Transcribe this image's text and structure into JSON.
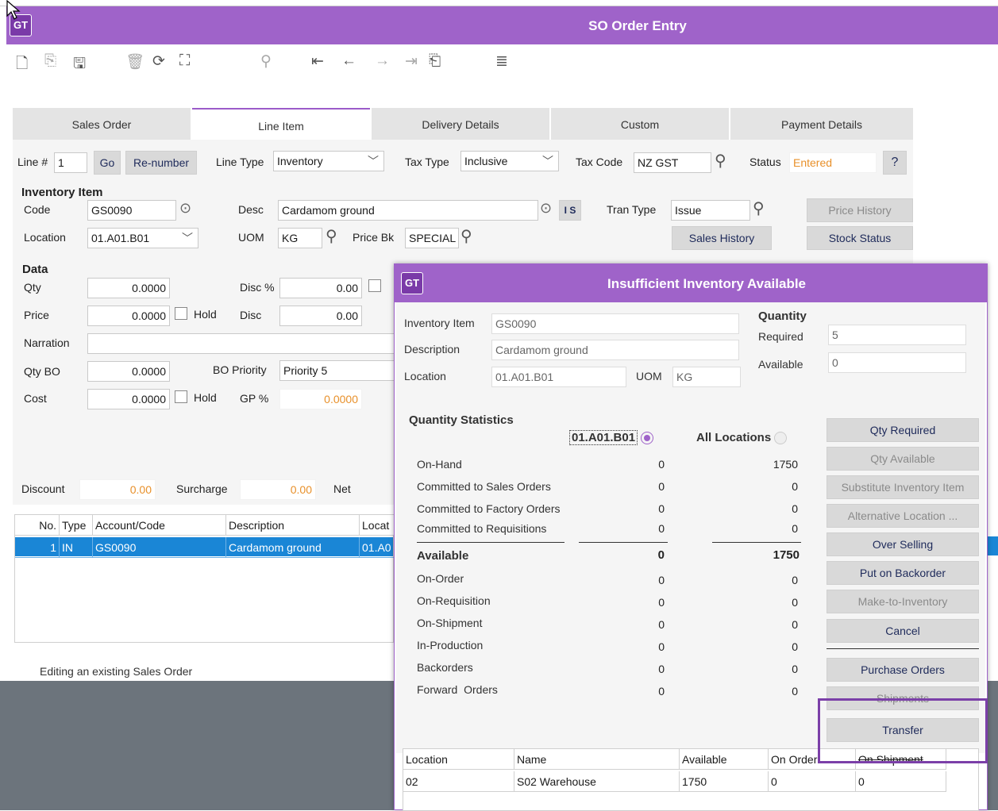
{
  "window": {
    "title": "SO Order Entry",
    "logo": "GT"
  },
  "toolbar": {
    "icons": [
      "new-icon",
      "copy-icon",
      "save-icon",
      "delete-icon",
      "refresh-icon",
      "tree-icon",
      "binoculars-icon",
      "first-icon",
      "prev-icon",
      "next-icon",
      "last-icon",
      "import-icon",
      "print-icon"
    ]
  },
  "tabs": [
    "Sales Order",
    "Line Item",
    "Delivery Details",
    "Custom",
    "Payment Details"
  ],
  "line": {
    "line_label": "Line #",
    "line_value": "1",
    "go": "Go",
    "renumber": "Re-number",
    "line_type_label": "Line Type",
    "line_type_value": "Inventory",
    "tax_type_label": "Tax Type",
    "tax_type_value": "Inclusive",
    "tax_code_label": "Tax Code",
    "tax_code_value": "NZ GST",
    "status_label": "Status",
    "status_value": "Entered"
  },
  "inventory": {
    "heading": "Inventory Item",
    "code_label": "Code",
    "code_value": "GS0090",
    "desc_label": "Desc",
    "desc_value": "Cardamom ground",
    "is_label": "I S",
    "tran_type_label": "Tran Type",
    "tran_type_value": "Issue",
    "price_history": "Price History",
    "location_label": "Location",
    "location_value": "01.A01.B01",
    "uom_label": "UOM",
    "uom_value": "KG",
    "price_bk_label": "Price Bk",
    "price_bk_value": "SPECIAL",
    "sales_history": "Sales History",
    "stock_status": "Stock Status"
  },
  "data": {
    "heading": "Data",
    "qty_label": "Qty",
    "qty_value": "0.0000",
    "disc_pct_label": "Disc %",
    "disc_pct_value": "0.00",
    "price_label": "Price",
    "price_value": "0.0000",
    "hold": "Hold",
    "disc_label": "Disc",
    "disc_value": "0.00",
    "narration_label": "Narration",
    "qty_bo_label": "Qty BO",
    "qty_bo_value": "0.0000",
    "bo_priority_label": "BO Priority",
    "bo_priority_value": "Priority 5",
    "cost_label": "Cost",
    "cost_value": "0.0000",
    "gp_label": "GP %",
    "gp_value": "0.0000"
  },
  "totals": {
    "discount_label": "Discount",
    "discount_value": "0.00",
    "surcharge_label": "Surcharge",
    "surcharge_value": "0.00",
    "net_label": "Net"
  },
  "lines_grid": {
    "headers": [
      "No.",
      "Type",
      "Account/Code",
      "Description",
      "Locat"
    ],
    "row": [
      "1",
      "IN",
      "GS0090",
      "Cardamom ground",
      "01.A0"
    ]
  },
  "status_bar": "Editing an existing Sales Order",
  "dialog": {
    "logo": "GT",
    "title": "Insufficient Inventory Available",
    "inv_item_label": "Inventory Item",
    "inv_item_value": "GS0090",
    "desc_label": "Description",
    "desc_value": "Cardamom ground",
    "location_label": "Location",
    "location_value": "01.A01.B01",
    "uom_label": "UOM",
    "uom_value": "KG",
    "quantity_heading": "Quantity",
    "required_label": "Required",
    "required_value": "5",
    "available_label": "Available",
    "available_value": "0",
    "stats_heading": "Quantity Statistics",
    "col_location": "01.A01.B01",
    "col_all": "All Locations",
    "stats": [
      {
        "label": "On-Hand",
        "loc": "0",
        "all": "1750"
      },
      {
        "label": "Committed to Sales Orders",
        "loc": "0",
        "all": "0"
      },
      {
        "label": "Committed to Factory Orders",
        "loc": "0",
        "all": "0"
      },
      {
        "label": "Committed to Requisitions",
        "loc": "0",
        "all": "0"
      }
    ],
    "available_row": {
      "label": "Available",
      "loc": "0",
      "all": "1750"
    },
    "stats2": [
      {
        "label": "On-Order",
        "loc": "0",
        "all": "0"
      },
      {
        "label": "On-Requisition",
        "loc": "0",
        "all": "0"
      },
      {
        "label": "On-Shipment",
        "loc": "0",
        "all": "0"
      },
      {
        "label": "In-Production",
        "loc": "0",
        "all": "0"
      },
      {
        "label": "Backorders",
        "loc": "0",
        "all": "0"
      },
      {
        "label": "Forward  Orders",
        "loc": "0",
        "all": "0"
      }
    ],
    "buttons": {
      "qty_required": "Qty Required",
      "qty_available": "Qty Available",
      "substitute": "Substitute Inventory Item",
      "alternative": "Alternative Location ...",
      "over_selling": "Over Selling",
      "backorder": "Put on Backorder",
      "make_to_inv": "Make-to-Inventory",
      "cancel": "Cancel",
      "purchase_orders": "Purchase Orders",
      "shipments": "Shipments",
      "transfer": "Transfer"
    },
    "grid": {
      "headers": [
        "Location",
        "Name",
        "Available",
        "On Order",
        "On Shipment"
      ],
      "row": [
        "02",
        "S02 Warehouse",
        "1750",
        "0",
        "0"
      ]
    }
  },
  "colors": {
    "title_bar": "#9f63c9",
    "highlight": "#7b3fa8",
    "selection": "#1a86d6",
    "accent_orange": "#e8902a"
  }
}
